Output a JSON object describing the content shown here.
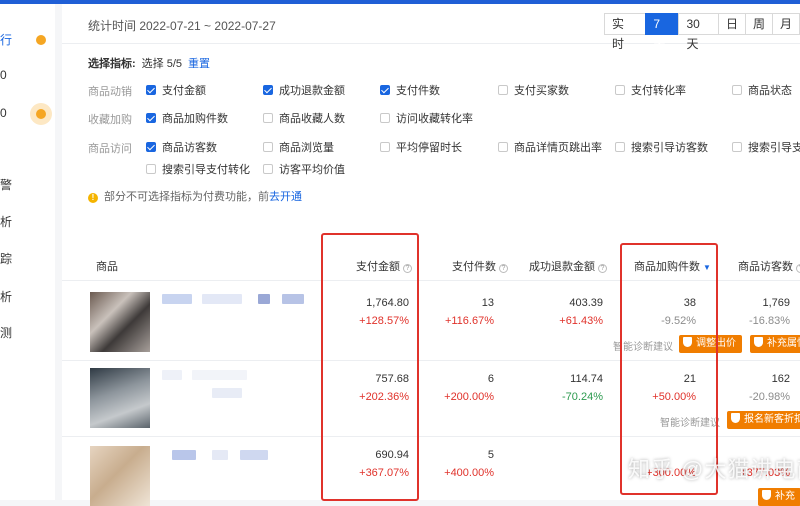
{
  "sidebar": {
    "items": [
      "行",
      "0",
      "0",
      "警",
      "析",
      "踪",
      "析",
      "测"
    ]
  },
  "header": {
    "stat_time": "统计时间 2022-07-21 ~ 2022-07-27",
    "ranges": [
      "实 时",
      "7天",
      "30天",
      "日",
      "周",
      "月"
    ],
    "active_range": "7天"
  },
  "selector": {
    "label": "选择指标:",
    "count": "选择 5/5",
    "reset": "重置"
  },
  "groups": {
    "product_action": "商品动销",
    "favorite_add": "收藏加购",
    "product_visit": "商品访问"
  },
  "options": {
    "pay_amount": "支付金额",
    "refund_amount": "成功退款金额",
    "pay_count": "支付件数",
    "pay_buyers": "支付买家数",
    "pay_conv": "支付转化率",
    "product_status": "商品状态",
    "cart_count": "商品加购件数",
    "fav_count": "商品收藏人数",
    "visit_fav_conv": "访问收藏转化率",
    "visitors": "商品访客数",
    "views": "商品浏览量",
    "avg_stay": "平均停留时长",
    "bounce": "商品详情页跳出率",
    "search_visitors": "搜索引导访客数",
    "search_buyers": "搜索引导支",
    "search_conv": "搜索引导支付转化",
    "visitor_value": "访客平均价值"
  },
  "note": {
    "text": "部分不可选择指标为付费功能，前",
    "link": "去开通"
  },
  "table": {
    "headers": {
      "product": "商品",
      "pay_amount": "支付金额",
      "pay_count": "支付件数",
      "refund_amount": "成功退款金额",
      "cart_count": "商品加购件数",
      "visitors": "商品访客数"
    },
    "rows": [
      {
        "pay_amount": "1,764.80",
        "pay_amount_chg": "+128.57%",
        "pay_count": "13",
        "pay_count_chg": "+116.67%",
        "refund": "403.39",
        "refund_chg": "+61.43%",
        "cart": "38",
        "cart_chg": "-9.52%",
        "visitors": "1,769",
        "visitors_chg": "-16.83%",
        "diag": "智能诊断建议",
        "btn1": "调整出价",
        "btn2": "补充属性"
      },
      {
        "pay_amount": "757.68",
        "pay_amount_chg": "+202.36%",
        "pay_count": "6",
        "pay_count_chg": "+200.00%",
        "refund": "114.74",
        "refund_chg": "-70.24%",
        "cart": "21",
        "cart_chg": "+50.00%",
        "visitors": "162",
        "visitors_chg": "-20.98%",
        "diag": "智能诊断建议",
        "btn1": "报名新客折扣"
      },
      {
        "pay_amount": "690.94",
        "pay_amount_chg": "+367.07%",
        "pay_count": "5",
        "pay_count_chg": "+400.00%",
        "refund": "",
        "refund_chg": "",
        "cart": "",
        "cart_chg": "+300.00%",
        "visitors": "",
        "visitors_chg": "+377.03%",
        "btn1": "补充"
      }
    ]
  },
  "watermark": "知乎 @大猫讲电商",
  "colors": {
    "accent": "#1966e0",
    "up": "#e0322b",
    "down": "#2b9a4e",
    "button": "#f07d00",
    "highlight_box": "#e0322b"
  }
}
